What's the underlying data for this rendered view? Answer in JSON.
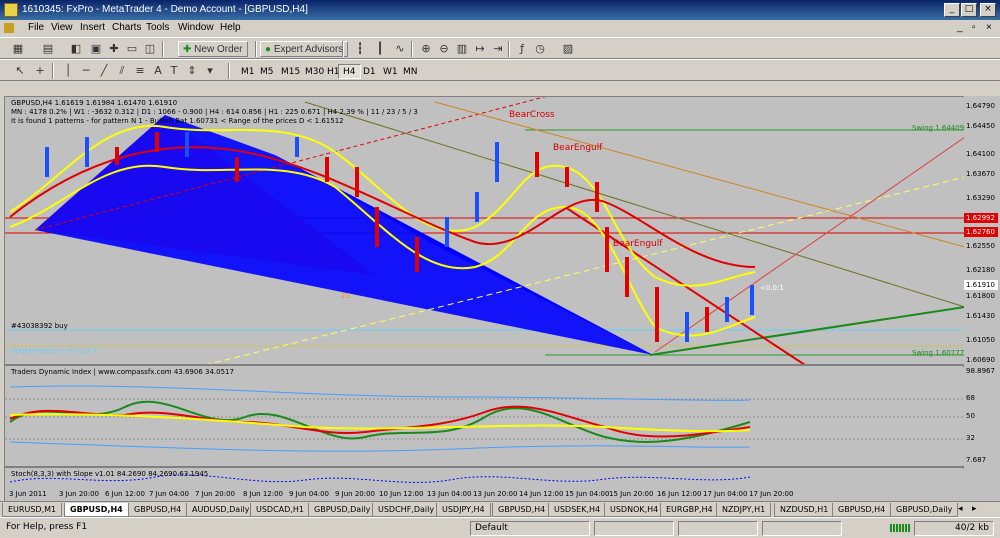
{
  "window": {
    "title": "1610345: FxPro - MetaTrader 4 - Demo Account - [GBPUSD,H4]",
    "controls": [
      "_",
      "□",
      "×"
    ]
  },
  "menu": [
    "File",
    "View",
    "Insert",
    "Charts",
    "Tools",
    "Window",
    "Help"
  ],
  "toolbar": {
    "new_order": "New Order",
    "expert_advisors": "Expert Advisors"
  },
  "timeframes": [
    "M1",
    "M5",
    "M15",
    "M30",
    "H1",
    "H4",
    "D1",
    "W1",
    "MN"
  ],
  "active_timeframe": "H4",
  "chart": {
    "symbol_line": "GBPUSD,H4  1.61619 1.61984 1.61470 1.61910",
    "info_line": "MN : 4178  0.2%  | W1 : -3632  0.312  | D1 : 1066 - 0.900  | H4 : 614  0.856 | H1 : 225  0.671  | H4  2.39 %  | 11 / 23 / 5 / 3",
    "pattern_line": "It is found 1 patterns - for pattern N 1 - Bullish Bat  1.60731 < Range of the prices D < 1.61512",
    "order_label": "#43038392 buy",
    "harmonics_label": "KorHarmonics v 6.7 13 T",
    "bear_cross": "BearCross",
    "bear_engulf_1": "BearEngulf",
    "bear_engulf_2": "BearEngulf",
    "swing_high": "Swing  1.64409",
    "swing_low": "Swing  1.60777",
    "ratio_label": "<0.0:1",
    "pct_label": "25"
  },
  "price_axis": {
    "labels": [
      "1.64790",
      "1.64450",
      "1.64100",
      "1.63670",
      "1.63290",
      "1.62992",
      "1.62760",
      "1.62550",
      "1.62180",
      "1.61910",
      "1.61800",
      "1.61430",
      "1.61050",
      "1.60690"
    ],
    "highlight_red_1": "1.62992",
    "highlight_red_2": "1.62760",
    "current_price": "1.61910"
  },
  "tdi": {
    "title": "Traders Dynamic Index | www.compassfx.com  43.6906  34.0517",
    "levels": [
      "98.8967",
      "68",
      "50",
      "32",
      "7.687"
    ]
  },
  "stoch": {
    "title": "Stoch(8,3,3) with Slope v1.01  84.2690  84.2690  63.1945"
  },
  "time_axis": [
    "3 Jun 2011",
    "3 Jun 20:00",
    "6 Jun 12:00",
    "7 Jun 04:00",
    "7 Jun 20:00",
    "8 Jun 12:00",
    "9 Jun 04:00",
    "9 Jun 20:00",
    "10 Jun 12:00",
    "13 Jun 04:00",
    "13 Jun 20:00",
    "14 Jun 12:00",
    "15 Jun 04:00",
    "15 Jun 20:00",
    "16 Jun 12:00",
    "17 Jun 04:00",
    "17 Jun 20:00"
  ],
  "tabs": [
    "EURUSD,M1",
    "GBPUSD,H4",
    "GBPUSD,H4",
    "AUDUSD,Daily",
    "USDCAD,H1",
    "GBPUSD,Daily",
    "USDCHF,Daily",
    "USDJPY,H4",
    "GBPUSD,H4",
    "USDSEK,H4",
    "USDNOK,H4",
    "EURGBP,H4",
    "NZDJPY,H1",
    "NZDUSD,H1",
    "GBPUSD,H4",
    "GBPUSD,Daily"
  ],
  "active_tab_index": 1,
  "status": {
    "help": "For Help, press F1",
    "profile": "Default",
    "traffic": "40/2 kb"
  },
  "colors": {
    "bearish_candle": "#e00000",
    "bullish_candle": "#1a4fff",
    "bands": "#ffff00",
    "pattern_red": "#f05a70",
    "pattern_blue": "#0000ff"
  }
}
